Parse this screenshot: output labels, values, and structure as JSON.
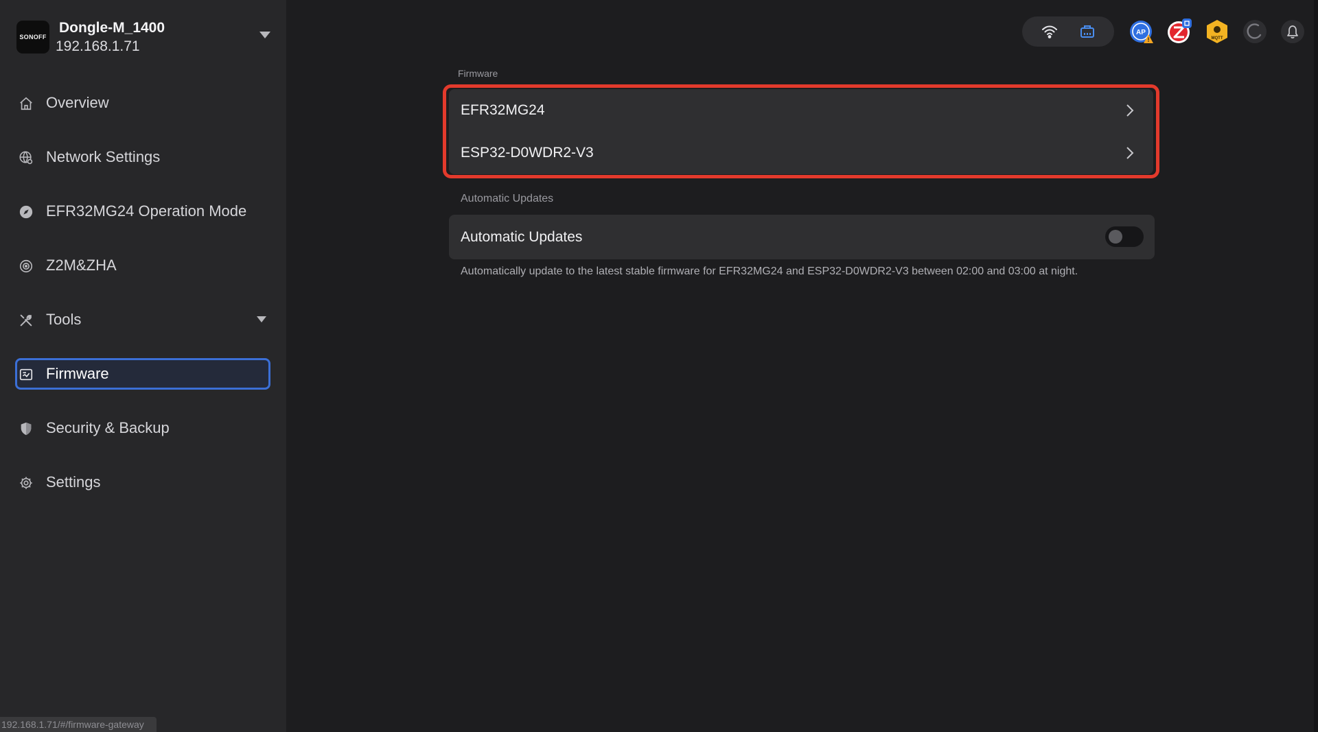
{
  "device": {
    "logo_text": "SONOFF",
    "name": "Dongle-M_1400",
    "ip": "192.168.1.71"
  },
  "sidebar": {
    "items": [
      {
        "label": "Overview",
        "icon": "home-icon"
      },
      {
        "label": "Network Settings",
        "icon": "globe-gear-icon"
      },
      {
        "label": "EFR32MG24 Operation Mode",
        "icon": "compass-icon"
      },
      {
        "label": "Z2M&ZHA",
        "icon": "radar-icon"
      },
      {
        "label": "Tools",
        "icon": "tools-icon",
        "expandable": true
      },
      {
        "label": "Firmware",
        "icon": "firmware-icon",
        "active": true
      },
      {
        "label": "Security & Backup",
        "icon": "shield-icon"
      },
      {
        "label": "Settings",
        "icon": "gear-icon"
      }
    ]
  },
  "topbar": {
    "icons": [
      "wifi-icon",
      "ethernet-icon",
      "access-point-icon",
      "zigbee2mqtt-icon",
      "mqtt-icon",
      "spinner-icon",
      "bell-icon"
    ]
  },
  "main": {
    "firmware_section_label": "Firmware",
    "firmware_items": [
      "EFR32MG24",
      "ESP32-D0WDR2-V3"
    ],
    "auto_section_label": "Automatic Updates",
    "auto_title": "Automatic Updates",
    "auto_enabled": false,
    "auto_description": "Automatically update to the latest stable firmware for EFR32MG24 and ESP32-D0WDR2-V3 between 02:00 and 03:00 at night."
  },
  "status_url": "192.168.1.71/#/firmware-gateway",
  "colors": {
    "accent": "#3b6fd6",
    "highlight_outline": "#e33a2c",
    "background": "#1d1d1f",
    "sidebar": "#272729"
  }
}
